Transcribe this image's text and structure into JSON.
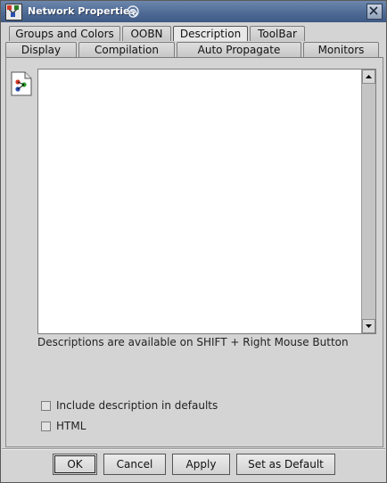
{
  "window": {
    "title": "Network Properties",
    "close_icon": "close-icon"
  },
  "tabs_row_top": [
    {
      "label": "Groups and Colors"
    },
    {
      "label": "OOBN"
    },
    {
      "label": "Description",
      "active": true
    },
    {
      "label": "ToolBar"
    }
  ],
  "tabs_row_bottom": [
    {
      "label": "Display"
    },
    {
      "label": "Compilation"
    },
    {
      "label": "Auto Propagate"
    },
    {
      "label": "Monitors"
    }
  ],
  "description": {
    "text": "",
    "hint": "Descriptions are available on SHIFT + Right Mouse Button"
  },
  "options": {
    "include_defaults": {
      "label": "Include description in defaults",
      "checked": false
    },
    "html": {
      "label": "HTML",
      "checked": false
    }
  },
  "buttons": {
    "ok": "OK",
    "cancel": "Cancel",
    "apply": "Apply",
    "set_default": "Set as Default"
  }
}
